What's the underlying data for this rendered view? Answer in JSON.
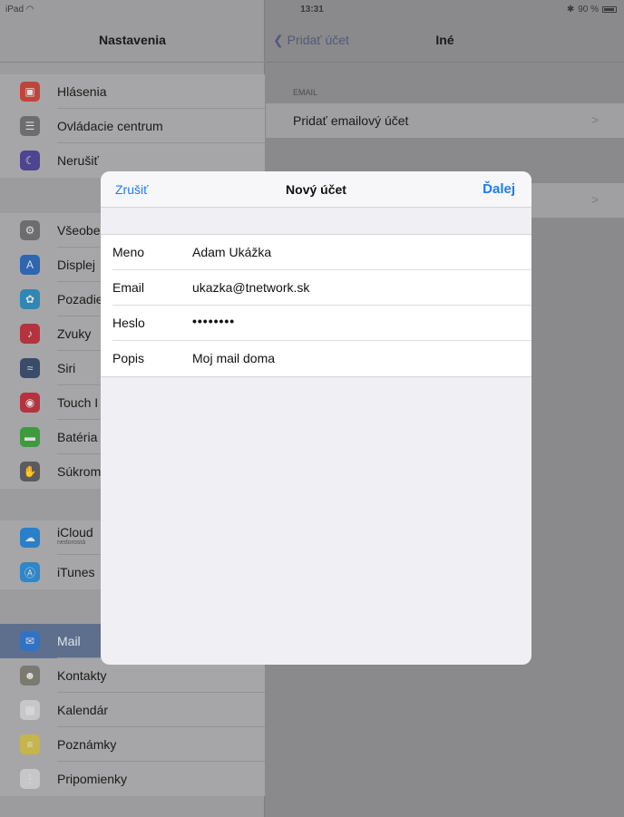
{
  "status_bar": {
    "device": "iPad",
    "time": "13:31",
    "battery": "90 %"
  },
  "sidebar": {
    "title": "Nastavenia",
    "groups": [
      {
        "items": [
          {
            "label": "Hlásenia",
            "icon": "notifications-icon",
            "color": "#c1443c"
          },
          {
            "label": "Ovládacie centrum",
            "icon": "control-center-icon",
            "color": "#6d6d70"
          },
          {
            "label": "Nerušiť",
            "icon": "moon-icon",
            "color": "#4d4590"
          }
        ]
      },
      {
        "items": [
          {
            "label": "Všeobe",
            "icon": "gear-icon",
            "color": "#6d6d70"
          },
          {
            "label": "Displej",
            "icon": "display-icon",
            "color": "#2e66b0"
          },
          {
            "label": "Pozadie",
            "icon": "wallpaper-icon",
            "color": "#2f87b5"
          },
          {
            "label": "Zvuky",
            "icon": "speaker-icon",
            "color": "#b3333f"
          },
          {
            "label": "Siri",
            "icon": "siri-icon",
            "color": "#3a4c6a"
          },
          {
            "label": "Touch I",
            "icon": "fingerprint-icon",
            "color": "#b3333f"
          },
          {
            "label": "Batéria",
            "icon": "battery-icon",
            "color": "#3f9a3f"
          },
          {
            "label": "Súkrom",
            "icon": "hand-icon",
            "color": "#5b5b5e"
          }
        ]
      },
      {
        "items": [
          {
            "label": "iCloud",
            "sublabel": "nedorostá",
            "icon": "cloud-icon",
            "color": "#2a7fc9"
          },
          {
            "label": "iTunes",
            "icon": "app-store-icon",
            "color": "#2f86c8"
          }
        ]
      },
      {
        "items": [
          {
            "label": "Mail",
            "icon": "mail-icon",
            "color": "#3172c4",
            "selected": true
          },
          {
            "label": "Kontakty",
            "icon": "contacts-icon",
            "color": "#7a7a70"
          },
          {
            "label": "Kalendár",
            "icon": "calendar-icon",
            "color": "#c7c7c9"
          },
          {
            "label": "Poznámky",
            "icon": "notes-icon",
            "color": "#c6b54a"
          },
          {
            "label": "Pripomienky",
            "icon": "reminders-icon",
            "color": "#c7c7c9"
          }
        ]
      }
    ]
  },
  "detail": {
    "back_label": "Pridať účet",
    "title": "Iné",
    "section_header": "EMAIL",
    "add_email_label": "Pridať emailový účet"
  },
  "modal": {
    "cancel_label": "Zrušiť",
    "title": "Nový účet",
    "next_label": "Ďalej",
    "fields": [
      {
        "label": "Meno",
        "value": "Adam Ukážka",
        "type": "text"
      },
      {
        "label": "Email",
        "value": "ukazka@tnetwork.sk",
        "type": "text"
      },
      {
        "label": "Heslo",
        "value": "••••••••",
        "type": "password"
      },
      {
        "label": "Popis",
        "value": "Moj mail doma",
        "type": "text"
      }
    ]
  },
  "colors": {
    "accent": "#1c7cf3",
    "overlay": "#8a8a8c"
  }
}
